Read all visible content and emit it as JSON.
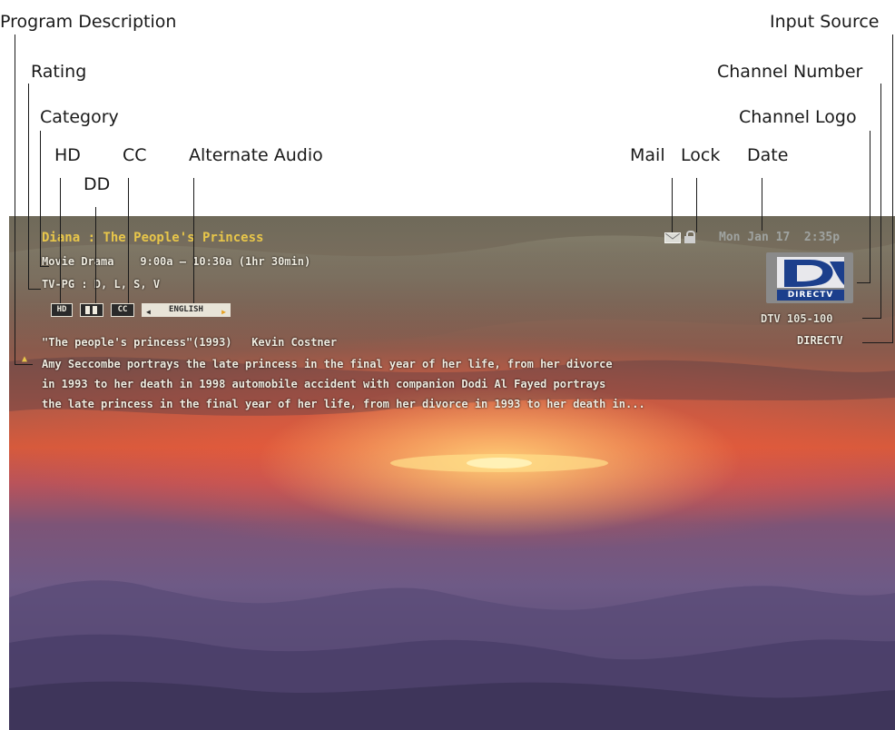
{
  "callouts": {
    "program_description": "Program Description",
    "input_source": "Input Source",
    "rating": "Rating",
    "channel_number": "Channel Number",
    "category": "Category",
    "channel_logo": "Channel Logo",
    "hd": "HD",
    "cc": "CC",
    "alternate_audio": "Alternate Audio",
    "mail": "Mail",
    "lock": "Lock",
    "date": "Date",
    "dd": "DD"
  },
  "program": {
    "title": "Diana : The People's Princess",
    "category_time": "Movie Drama    9:00a – 10:30a (1hr 30min)",
    "rating": "TV-PG : D, L, S, V",
    "badges": {
      "hd": "HD",
      "dd": "DD",
      "cc": "CC",
      "audio": "ENGLISH"
    },
    "subtitle": "\"The people's princess\"(1993)   Kevin Costner",
    "description": [
      "Amy Seccombe portrays the late princess in the final year of her life, from her divorce",
      "in 1993 to her death in 1998 automobile accident with companion Dodi Al Fayed portrays",
      "the late princess in the final year of her life, from her divorce in 1993 to her death in..."
    ]
  },
  "status": {
    "datetime": "Mon Jan 17  2:35p"
  },
  "channel": {
    "logo_text": "DIRECTV",
    "number": "DTV 105-100",
    "source": "DIRECTV"
  },
  "colors": {
    "title": "#e8c64a",
    "text": "#f0ece0",
    "logo_blue": "#1c3f8c"
  },
  "icons": [
    "mail-icon",
    "lock-icon",
    "scroll-up-arrow-icon",
    "directv-logo-icon",
    "dd-icon"
  ]
}
